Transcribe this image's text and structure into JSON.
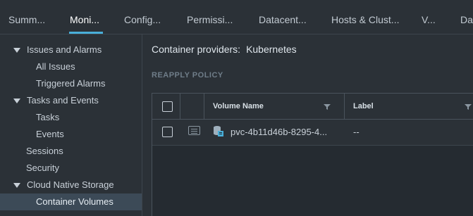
{
  "tabs": [
    {
      "label": "Summ..."
    },
    {
      "label": "Moni..."
    },
    {
      "label": "Config..."
    },
    {
      "label": "Permissi..."
    },
    {
      "label": "Datacent..."
    },
    {
      "label": "Hosts & Clust..."
    },
    {
      "label": "V..."
    },
    {
      "label": "Da"
    }
  ],
  "active_tab": "Moni...",
  "accent_color": "#49afd9",
  "sidebar": {
    "items": [
      {
        "label": "Issues and Alarms"
      },
      {
        "label": "All Issues"
      },
      {
        "label": "Triggered Alarms"
      },
      {
        "label": "Tasks and Events"
      },
      {
        "label": "Tasks"
      },
      {
        "label": "Events"
      },
      {
        "label": "Sessions"
      },
      {
        "label": "Security"
      },
      {
        "label": "Cloud Native Storage"
      },
      {
        "label": "Container Volumes"
      }
    ],
    "selected": "Container Volumes"
  },
  "main": {
    "providers_label": "Container providers:",
    "providers_value": "Kubernetes",
    "reapply_label": "REAPPLY POLICY",
    "grid": {
      "columns": [
        "Volume Name",
        "Label"
      ],
      "rows": [
        {
          "volume_name": "pvc-4b11d46b-8295-4...",
          "label": "--"
        }
      ]
    }
  },
  "icons": {
    "filter": "filter-icon",
    "volume": "volume-icon",
    "detail": "detail-icon",
    "caret": "caret-down-icon"
  }
}
